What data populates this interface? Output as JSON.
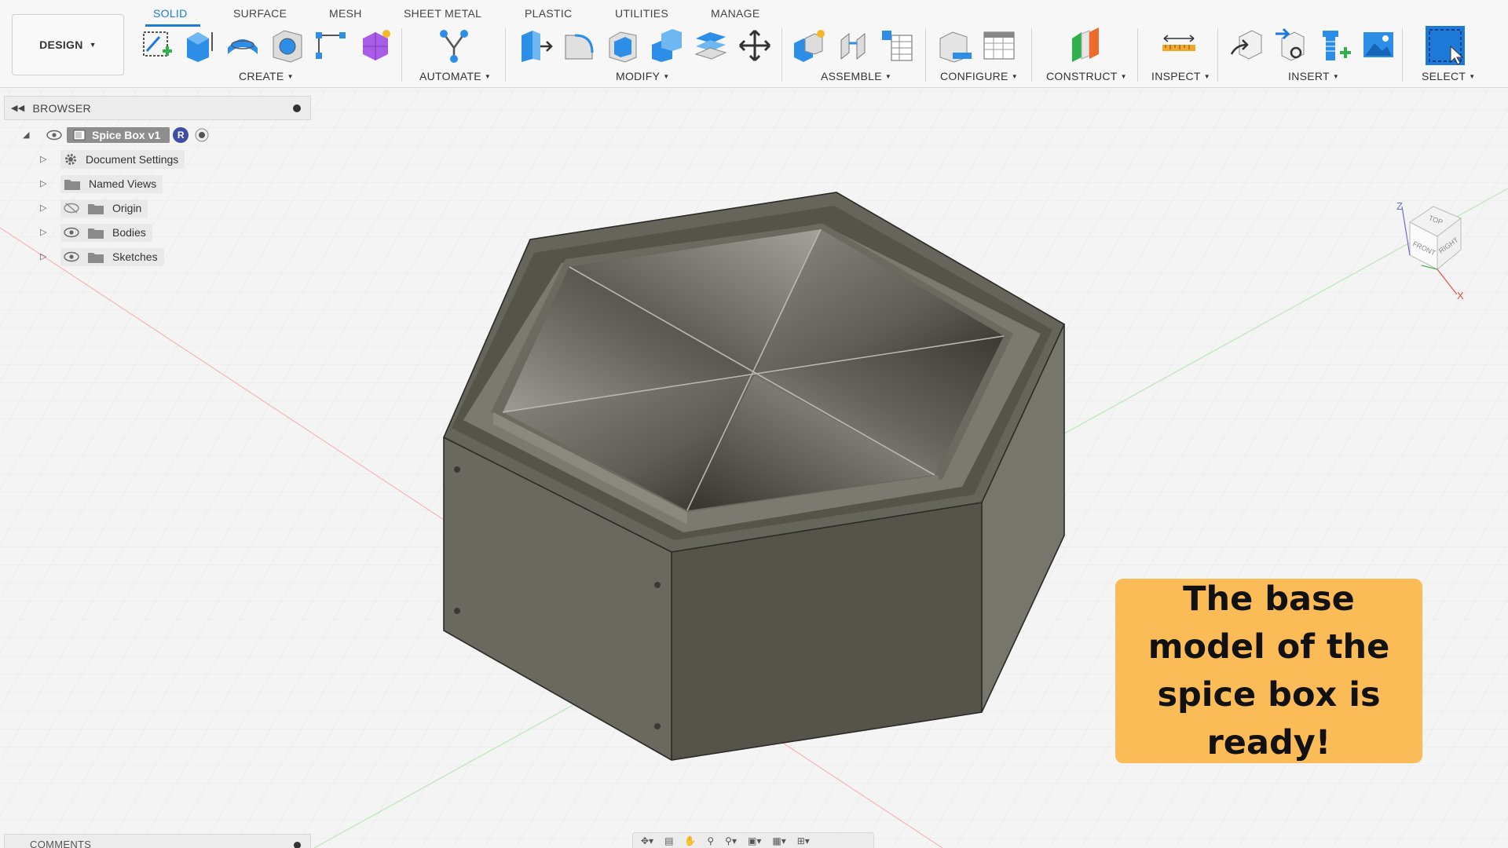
{
  "toolbar": {
    "workspace": "DESIGN",
    "tabs": [
      {
        "label": "SOLID",
        "active": true
      },
      {
        "label": "SURFACE",
        "active": false
      },
      {
        "label": "MESH",
        "active": false
      },
      {
        "label": "SHEET METAL",
        "active": false
      },
      {
        "label": "PLASTIC",
        "active": false
      },
      {
        "label": "UTILITIES",
        "active": false
      },
      {
        "label": "MANAGE",
        "active": false
      }
    ],
    "groups": [
      {
        "label": "CREATE"
      },
      {
        "label": "AUTOMATE"
      },
      {
        "label": "MODIFY"
      },
      {
        "label": "ASSEMBLE"
      },
      {
        "label": "CONFIGURE"
      },
      {
        "label": "CONSTRUCT"
      },
      {
        "label": "INSPECT"
      },
      {
        "label": "INSERT"
      },
      {
        "label": "SELECT"
      }
    ],
    "accent_color": "#1e7ad8"
  },
  "browser": {
    "title": "BROWSER",
    "root": {
      "label": "Spice Box v1",
      "badge": "R"
    },
    "items": [
      {
        "label": "Document Settings",
        "icon": "gear-icon"
      },
      {
        "label": "Named Views",
        "icon": "folder-icon"
      },
      {
        "label": "Origin",
        "icon": "folder-icon",
        "hidden": true
      },
      {
        "label": "Bodies",
        "icon": "folder-icon"
      },
      {
        "label": "Sketches",
        "icon": "folder-icon"
      }
    ]
  },
  "viewcube": {
    "top": "TOP",
    "front": "FRONT",
    "right": "RIGHT",
    "z_axis": "Z",
    "x_axis": "X"
  },
  "comments": {
    "title": "COMMENTS"
  },
  "callout": {
    "text": "The base model of the spice box is ready!",
    "color": "#fbbb57"
  }
}
